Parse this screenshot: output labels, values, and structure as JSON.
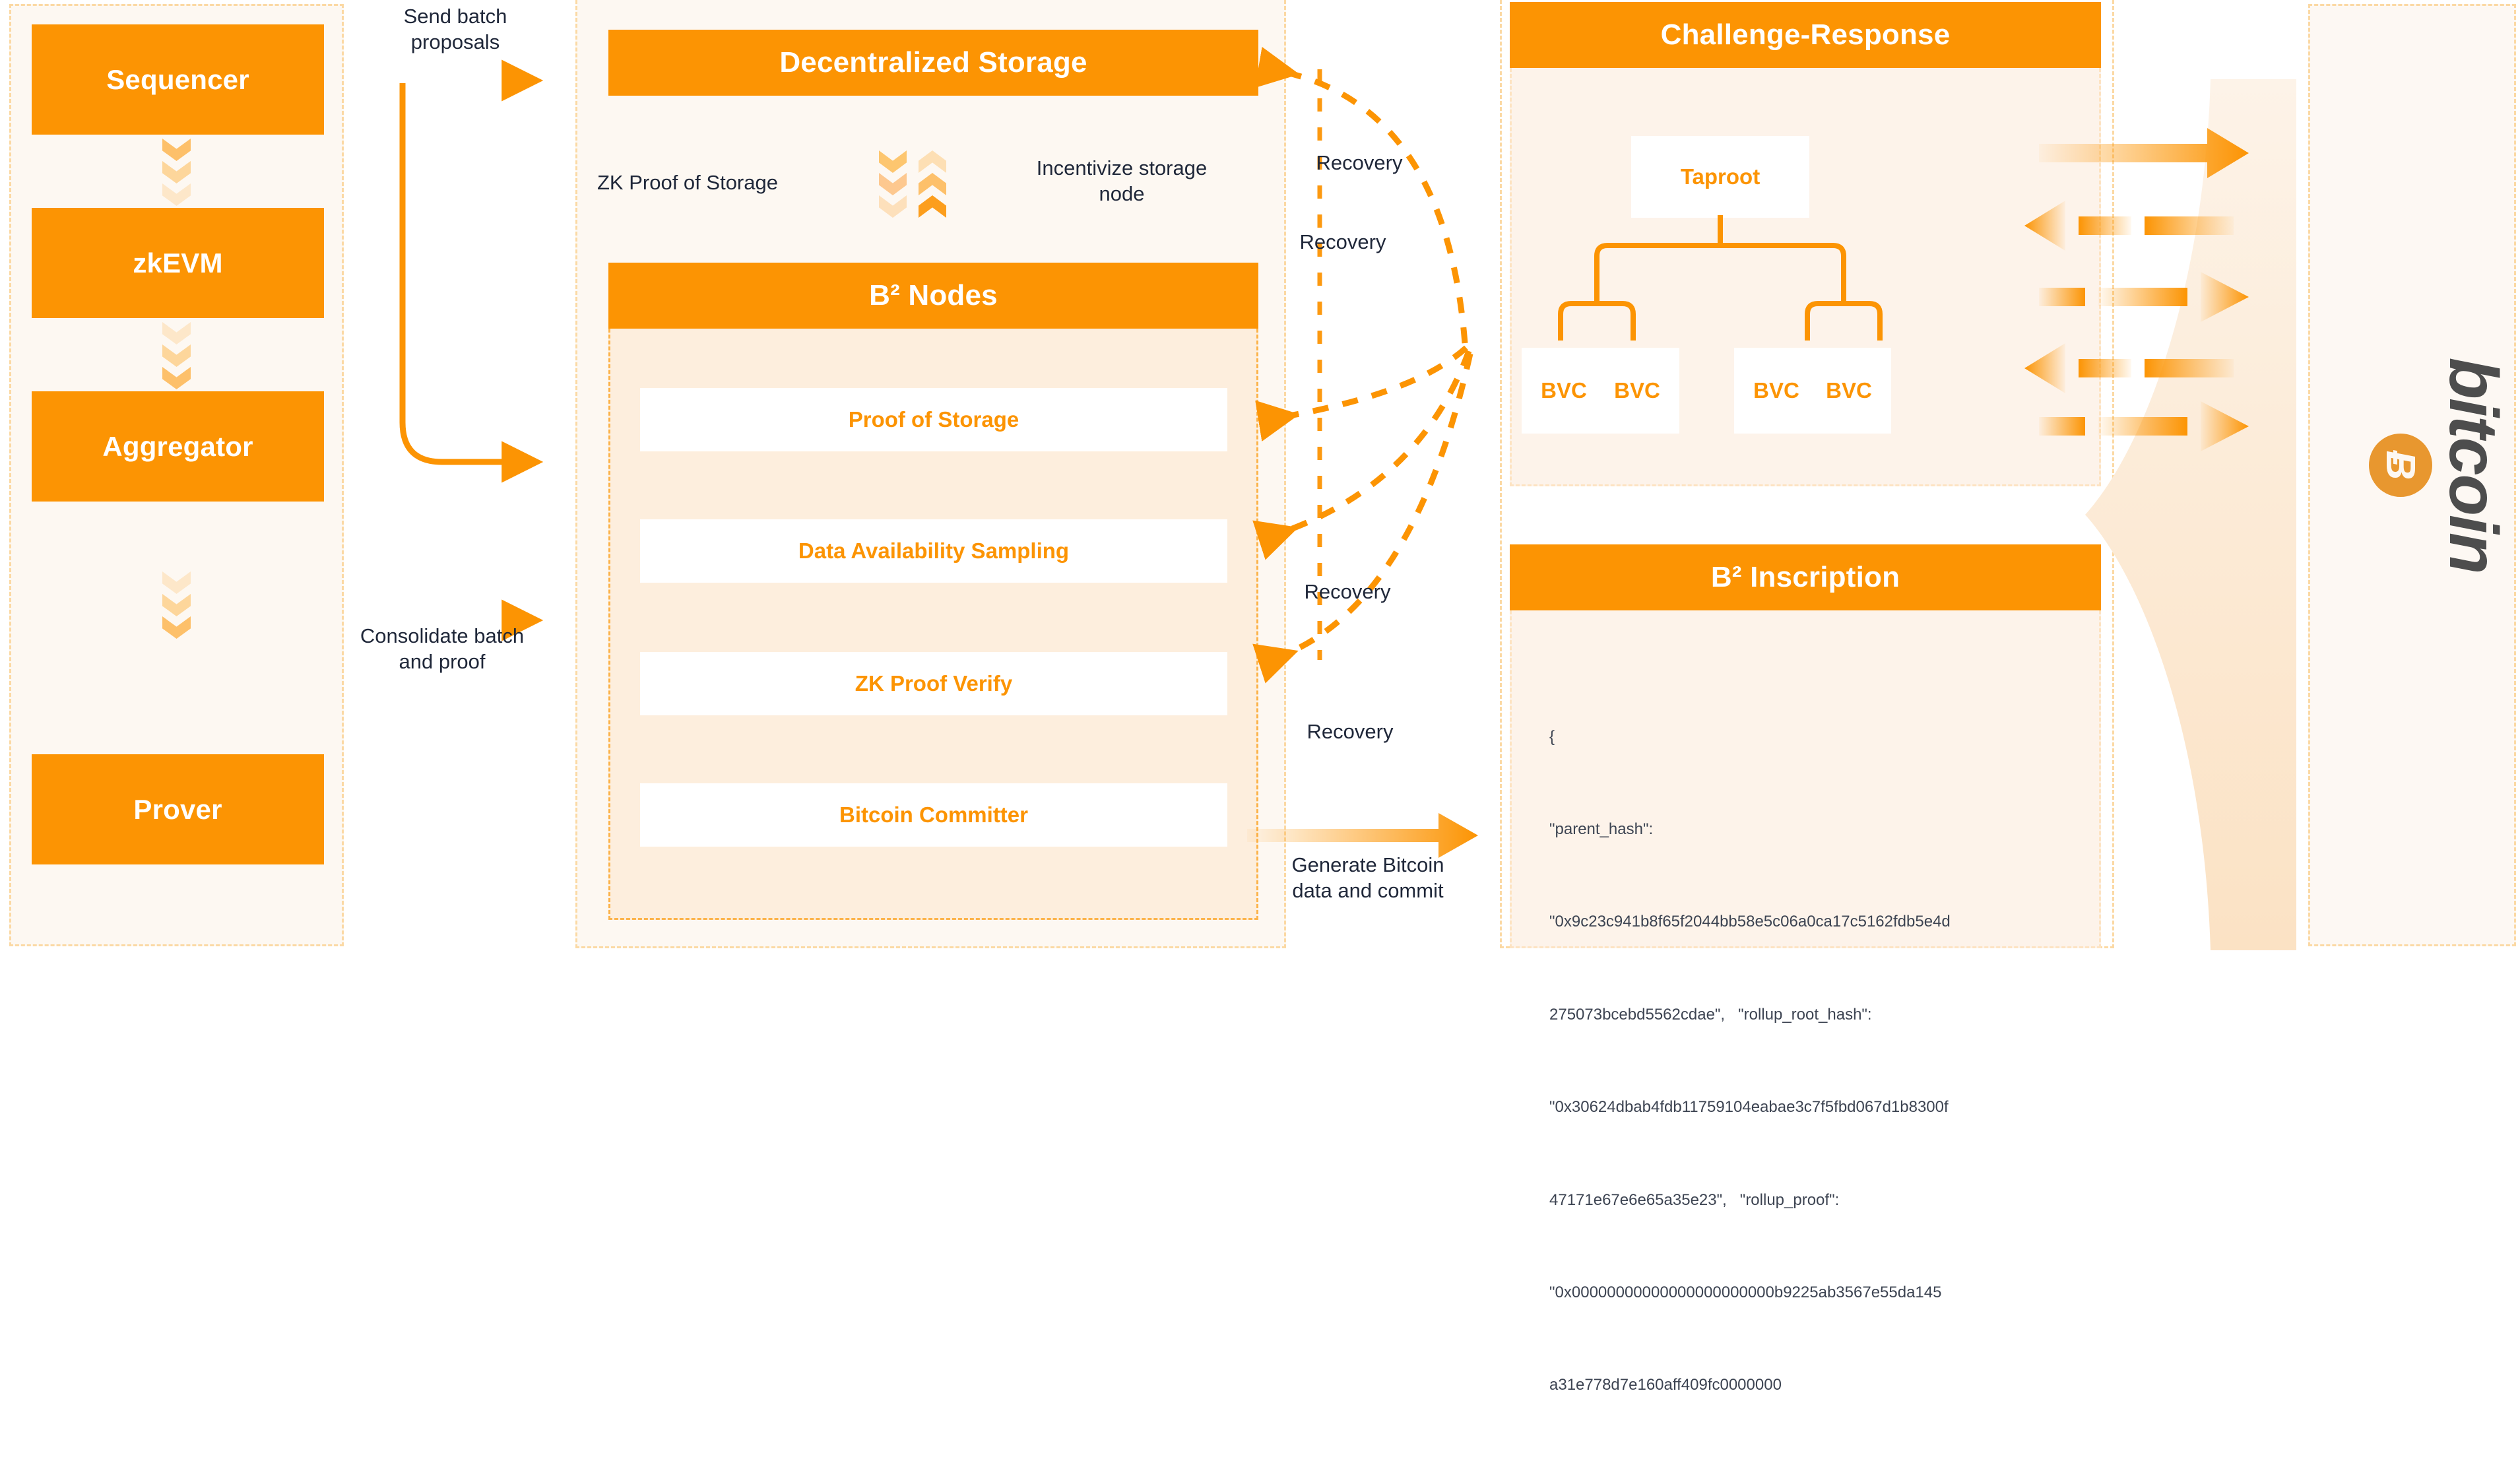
{
  "colors": {
    "orange": "#fc9403",
    "orange_light": "#fdc06a",
    "orange_pale": "#fde0b7",
    "bg": "#fdf8f2",
    "card_text": "#fc9403",
    "text_dark": "#1f2739",
    "code_text": "#3d4452",
    "bitcoin_gray": "#4d4d4d",
    "bitcoin_coin": "#e8972f"
  },
  "rollup_column": {
    "blocks": [
      {
        "label": "Sequencer"
      },
      {
        "label": "zkEVM"
      },
      {
        "label": "Aggregator"
      },
      {
        "label": "Prover"
      }
    ],
    "connector_icon": "chevron-down-icon"
  },
  "flow_labels": {
    "send_batch": "Send batch\nproposals",
    "consolidate": "Consolidate batch\nand proof",
    "generate_commit": "Generate Bitcoin\ndata and commit",
    "recovery": "Recovery",
    "recovery_list": [
      "Recovery",
      "Recovery",
      "Recovery",
      "Recovery"
    ]
  },
  "storage_section": {
    "title": "Decentralized Storage",
    "left_label": "ZK Proof of Storage",
    "right_label": "Incentivize storage\nnode",
    "down_icon": "chevron-down-icon",
    "up_icon": "chevron-up-icon"
  },
  "nodes_section": {
    "title": "B² Nodes",
    "items": [
      {
        "label": "Proof of Storage"
      },
      {
        "label": "Data Availability Sampling"
      },
      {
        "label": "ZK Proof Verify"
      },
      {
        "label": "Bitcoin Committer"
      }
    ]
  },
  "challenge_section": {
    "title": "Challenge-Response",
    "root": "Taproot",
    "leaves": [
      "BVC",
      "BVC",
      "BVC",
      "BVC"
    ]
  },
  "inscription_section": {
    "title": "B²  Inscription",
    "code_lines": [
      "{",
      "\"parent_hash\":",
      "\"0x9c23c941b8f65f2044bb58e5c06a0ca17c5162fdb5e4d",
      "275073bcebd5562cdae\",   \"rollup_root_hash\":",
      "\"0x30624dbab4fdb11759104eabae3c7f5fbd067d1b8300f",
      "47171e67e6e65a35e23\",   \"rollup_proof\":",
      "\"0x00000000000000000000000b9225ab3567e55da145",
      "a31e778d7e160aff409fc0000000"
    ]
  },
  "bitcoin_section": {
    "wordmark": "bitcoin",
    "coin_symbol": "Ƀ",
    "arrows": [
      {
        "direction": "right",
        "style": "solid"
      },
      {
        "direction": "left",
        "style": "dashed"
      },
      {
        "direction": "right",
        "style": "dashed"
      },
      {
        "direction": "left",
        "style": "dashed"
      },
      {
        "direction": "right",
        "style": "dashed"
      }
    ]
  }
}
